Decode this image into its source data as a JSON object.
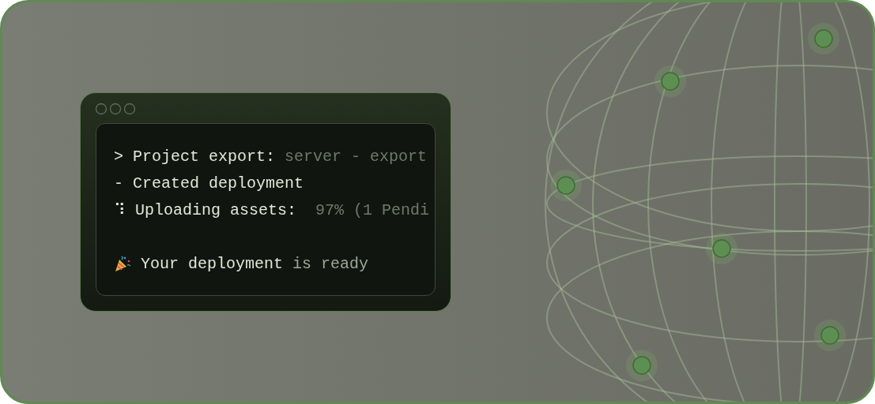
{
  "terminal": {
    "lines": [
      {
        "kind": "command",
        "prefix": ">",
        "text": "Project export:",
        "dim": "server - export"
      },
      {
        "kind": "step",
        "prefix": "-",
        "text": "Created deployment"
      },
      {
        "kind": "progress",
        "prefix": "⠹",
        "text": "Uploading assets:",
        "dim": " 97% (1 Pendi"
      },
      {
        "kind": "blank"
      },
      {
        "kind": "success",
        "text": "Your deployment",
        "dim": "is ready"
      }
    ]
  }
}
